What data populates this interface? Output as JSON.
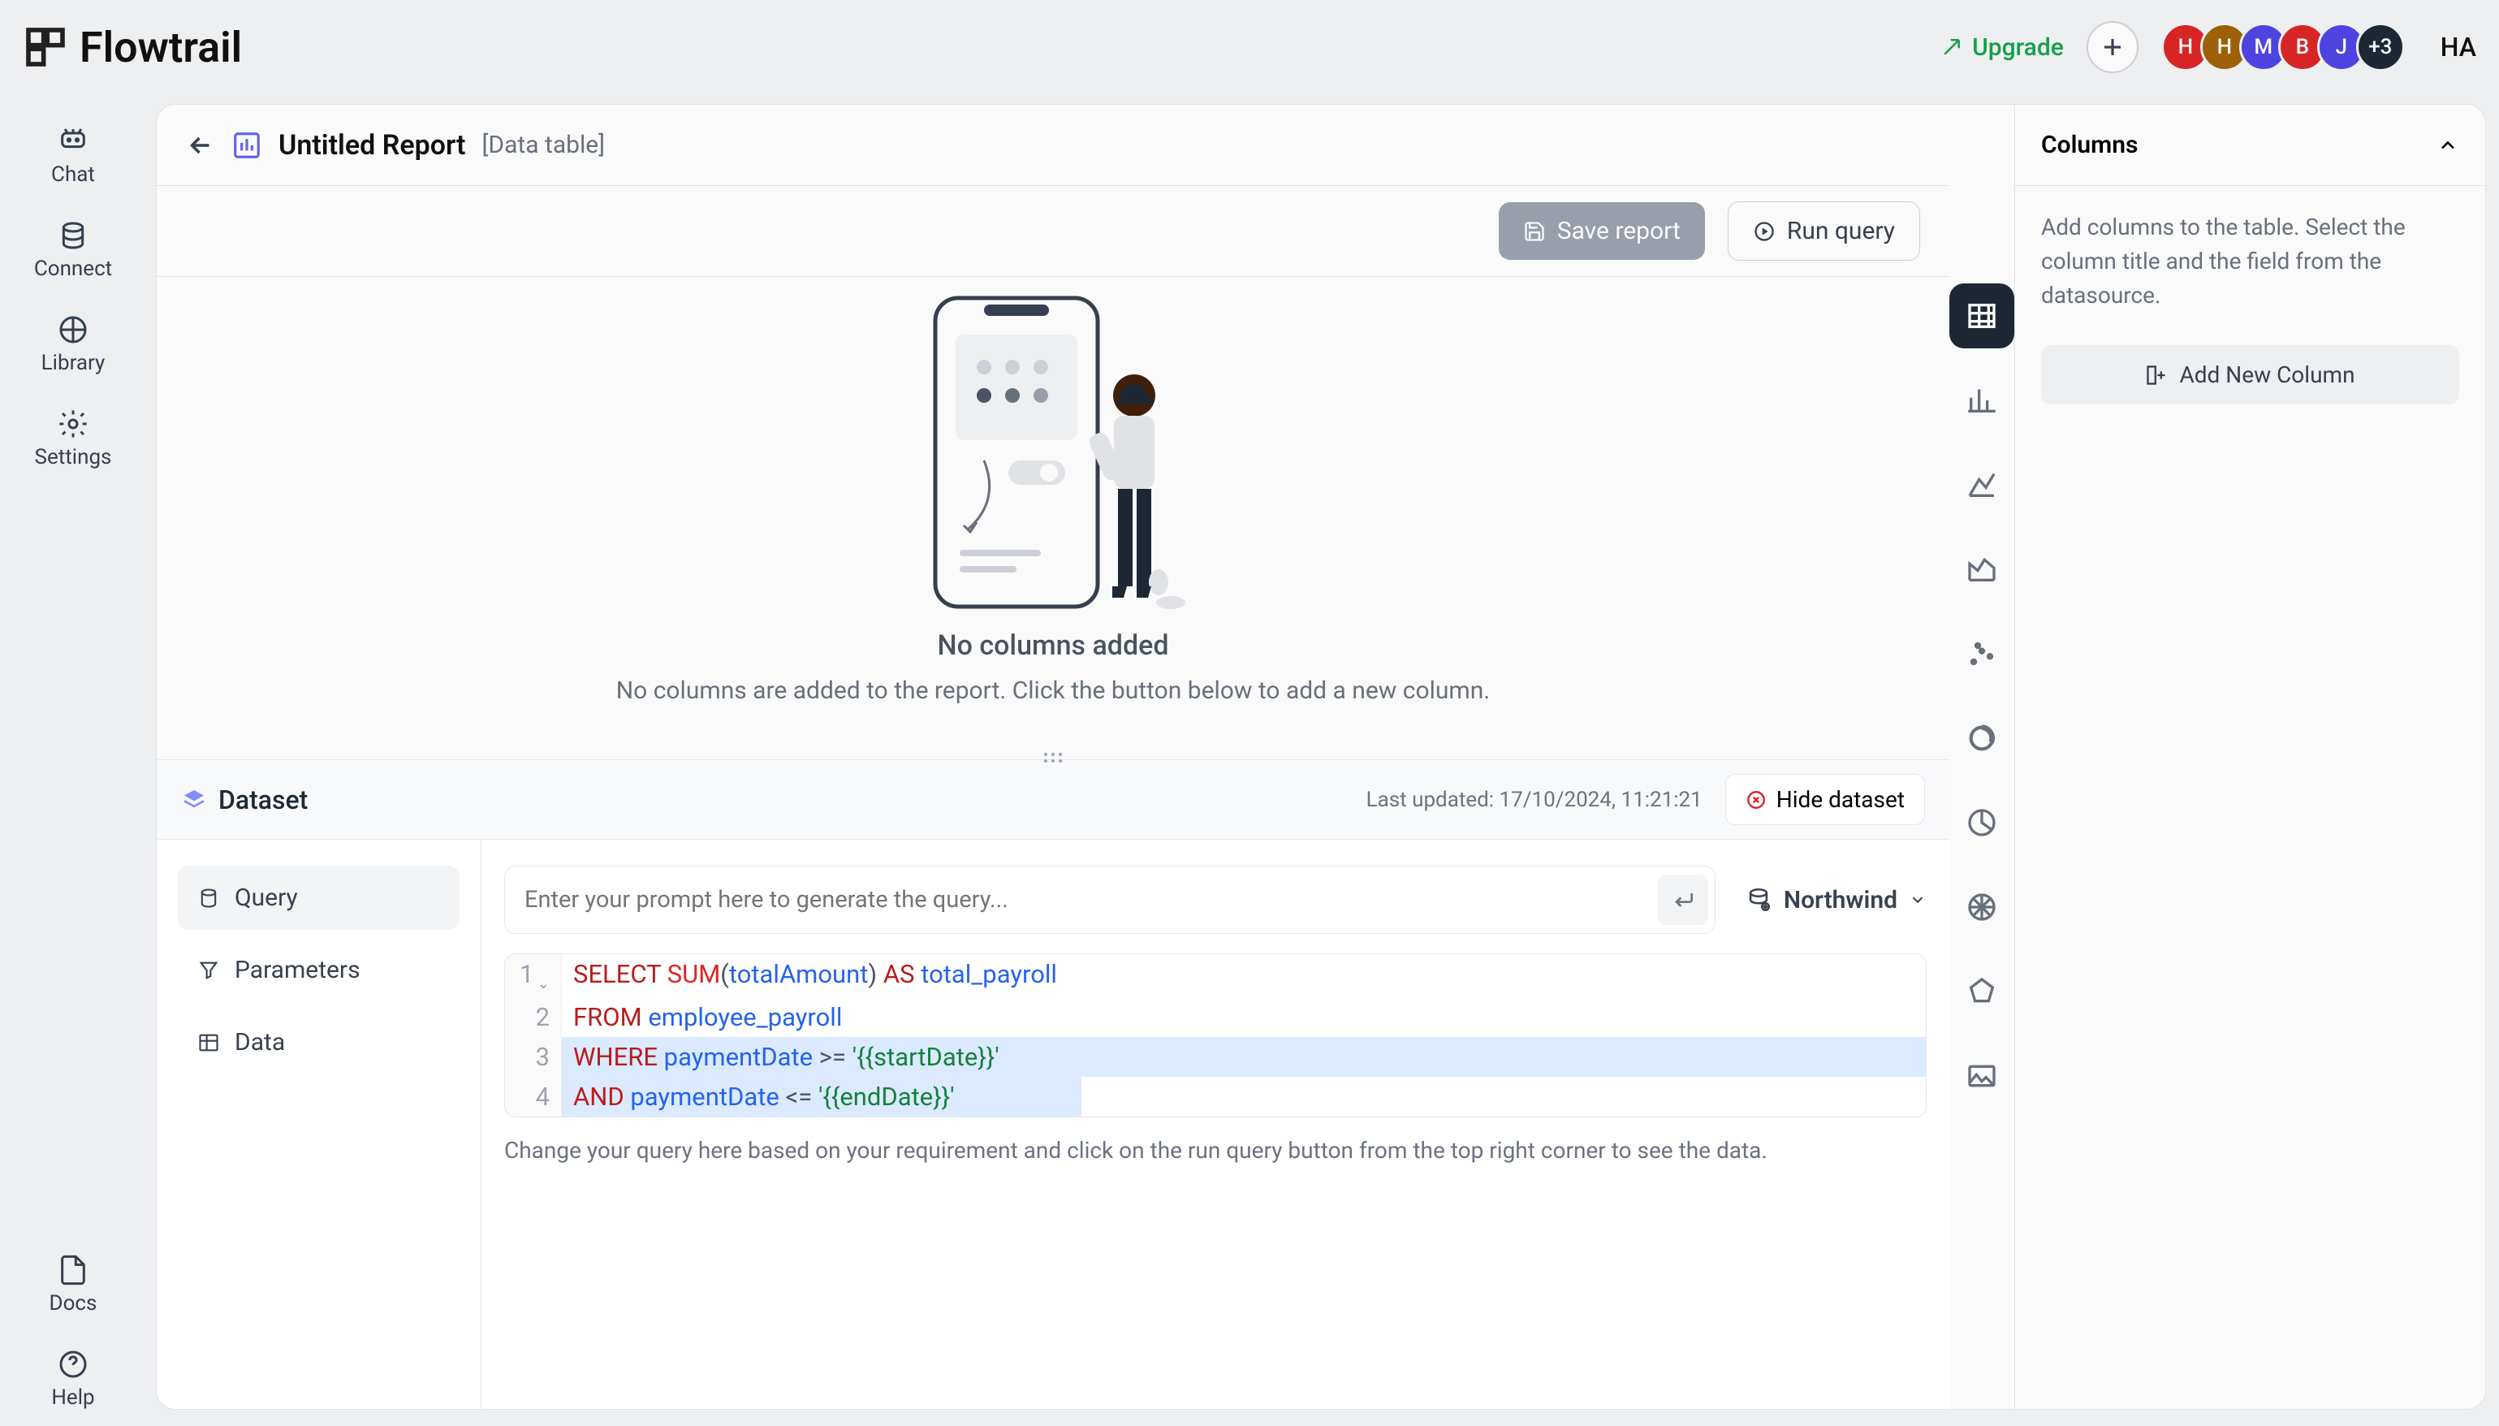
{
  "brand": "Flowtrail",
  "topbar": {
    "upgrade_label": "Upgrade",
    "user_label": "HA",
    "avatars": [
      {
        "text": "H",
        "bg": "#dc2626"
      },
      {
        "text": "H",
        "bg": "#a16207"
      },
      {
        "text": "M",
        "bg": "#4f46e5"
      },
      {
        "text": "B",
        "bg": "#dc2626"
      },
      {
        "text": "J",
        "bg": "#4f46e5"
      },
      {
        "text": "+3",
        "bg": "#1f2937"
      }
    ]
  },
  "leftnav": {
    "chat": "Chat",
    "connect": "Connect",
    "library": "Library",
    "settings": "Settings",
    "docs": "Docs",
    "help": "Help"
  },
  "header": {
    "title": "Untitled Report",
    "type": "[Data table]"
  },
  "toolbar": {
    "save_label": "Save report",
    "run_label": "Run query"
  },
  "empty": {
    "title": "No columns added",
    "subtitle": "No columns are added to the report. Click the button below to add a new column."
  },
  "right_panel": {
    "heading": "Columns",
    "description": "Add columns to the table. Select the column title and the field from the datasource.",
    "add_button": "Add New Column"
  },
  "dataset": {
    "title": "Dataset",
    "last_updated": "Last updated: 17/10/2024, 11:21:21",
    "hide_label": "Hide dataset",
    "tabs": {
      "query": "Query",
      "parameters": "Parameters",
      "data": "Data"
    },
    "prompt_placeholder": "Enter your prompt here to generate the query...",
    "datasource": "Northwind",
    "code": {
      "l1": {
        "kw1": "SELECT",
        "fn": "SUM",
        "id": "totalAmount",
        "kw2": "AS",
        "alias": "total_payroll"
      },
      "l2": {
        "kw": "FROM",
        "id": "employee_payroll"
      },
      "l3": {
        "kw": "WHERE",
        "id": "paymentDate",
        "op": ">=",
        "str": "'{{startDate}}'"
      },
      "l4": {
        "kw": "AND",
        "id": "paymentDate",
        "op": "<=",
        "str": "'{{endDate}}'"
      }
    },
    "help": "Change your query here based on your requirement and click on the run query button from the top right corner to see the data."
  }
}
